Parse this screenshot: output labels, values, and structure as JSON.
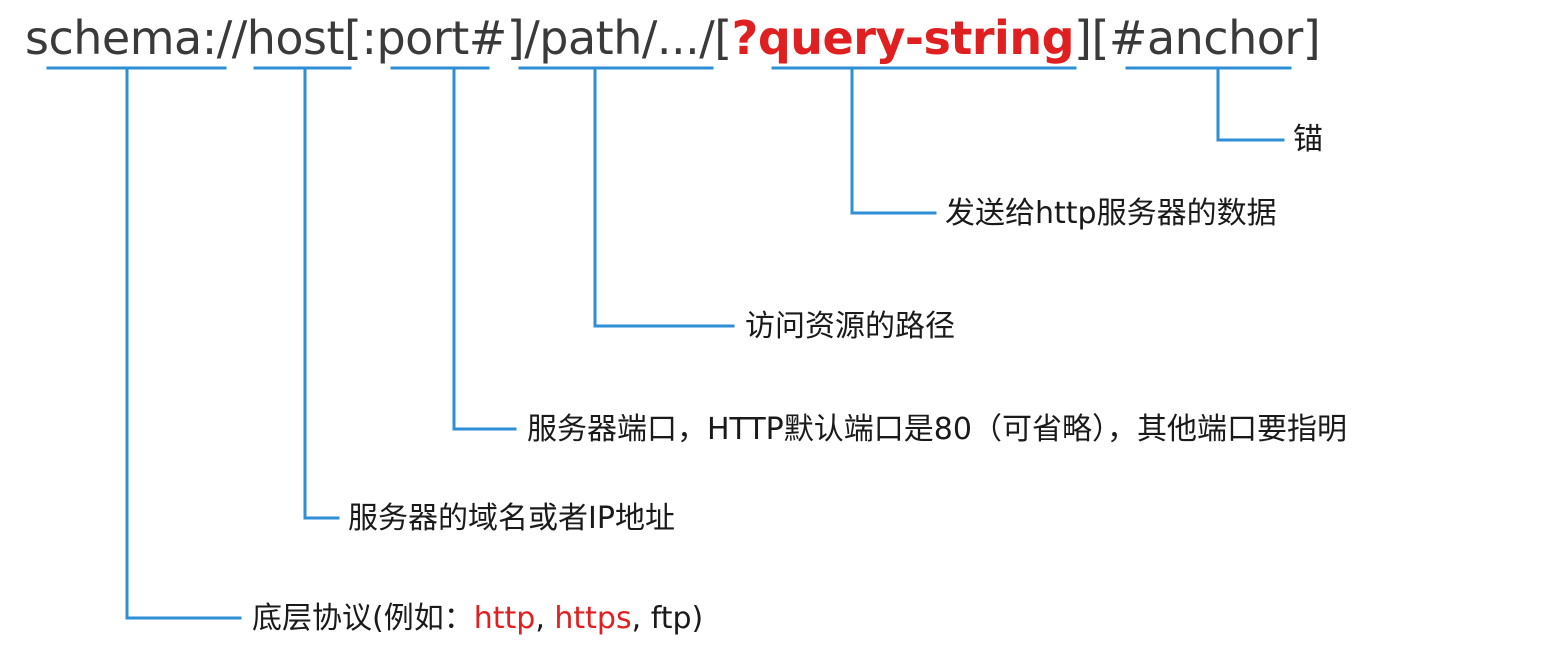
{
  "url_template": {
    "scheme": "schema://",
    "host": "host",
    "port": "[:port#]",
    "path": "/path/.../",
    "query_open": "[",
    "query": "?query-string",
    "query_close": "]",
    "anchor": "[#anchor]"
  },
  "callouts": {
    "anchor": "锚",
    "query": "发送给http服务器的数据",
    "path": "访问资源的路径",
    "port": "服务器端口，HTTP默认端口是80（可省略），其他端口要指明",
    "host": "服务器的域名或者IP地址",
    "scheme": {
      "prefix": "底层协议(例如：",
      "example1": "http",
      "sep1": ", ",
      "example2": "https",
      "sep2": ", ",
      "example3": "ftp",
      "suffix": ")"
    }
  },
  "colors": {
    "connector": "#2e8fd6",
    "accent": "#e02020",
    "text": "#1a1a1a"
  }
}
